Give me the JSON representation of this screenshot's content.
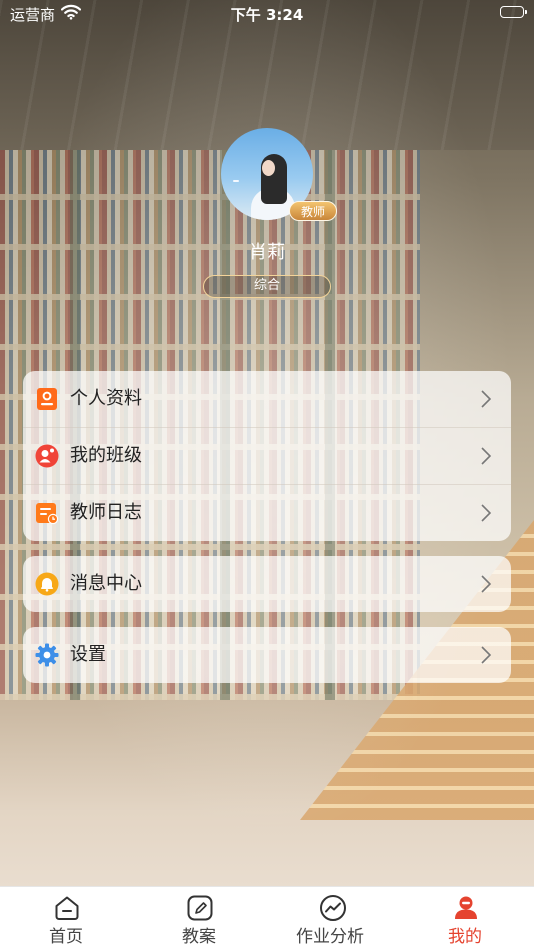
{
  "status_bar": {
    "carrier": "运营商",
    "time": "下午 3:24",
    "battery_level": 1.0
  },
  "profile": {
    "name": "肖莉",
    "role_badge": "教师",
    "subject": "综合"
  },
  "menu_groups": [
    [
      {
        "label": "个人资料",
        "icon": "profile-card-icon",
        "color": "#ff6a1a"
      },
      {
        "label": "我的班级",
        "icon": "class-users-icon",
        "color": "#f04438"
      },
      {
        "label": "教师日志",
        "icon": "teacher-log-icon",
        "color": "#ff7a1a"
      }
    ],
    [
      {
        "label": "消息中心",
        "icon": "bell-icon",
        "color": "#f7a817"
      }
    ],
    [
      {
        "label": "设置",
        "icon": "gear-icon",
        "color": "#3d8fe8"
      }
    ]
  ],
  "tab_bar": {
    "active_index": 3,
    "active_color": "#e5432f",
    "tabs": [
      {
        "label": "首页",
        "icon": "home-icon"
      },
      {
        "label": "教案",
        "icon": "lesson-plan-icon"
      },
      {
        "label": "作业分析",
        "icon": "analysis-icon"
      },
      {
        "label": "我的",
        "icon": "person-icon"
      }
    ]
  }
}
